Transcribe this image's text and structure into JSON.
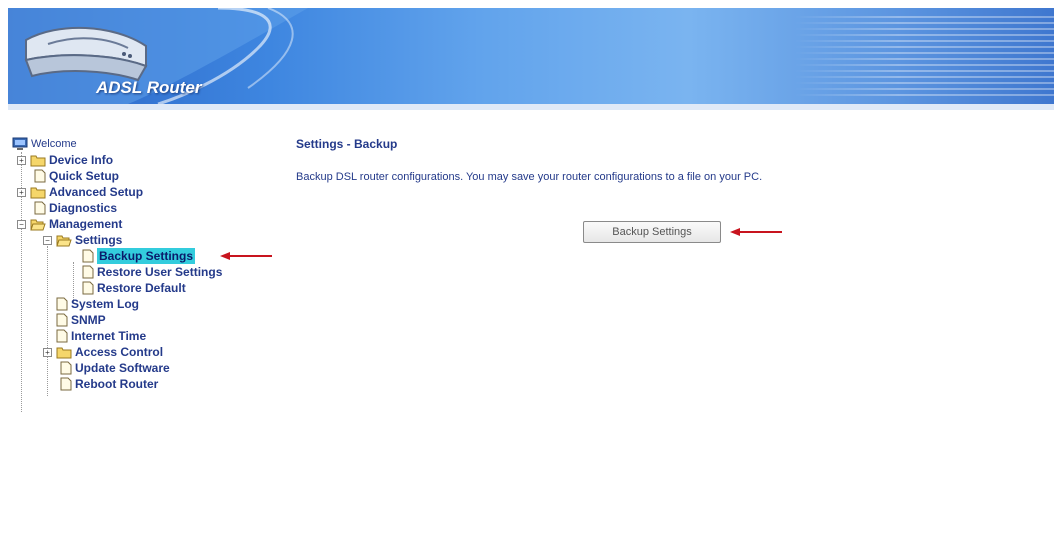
{
  "header": {
    "brand": "ADSL Router"
  },
  "tree": {
    "root": "Welcome",
    "items": [
      {
        "label": "Device Info"
      },
      {
        "label": "Quick Setup"
      },
      {
        "label": "Advanced Setup"
      },
      {
        "label": "Diagnostics"
      },
      {
        "label": "Management"
      },
      {
        "label": "Settings"
      },
      {
        "label": "Backup Settings"
      },
      {
        "label": "Restore User Settings"
      },
      {
        "label": "Restore Default"
      },
      {
        "label": "System Log"
      },
      {
        "label": "SNMP"
      },
      {
        "label": "Internet Time"
      },
      {
        "label": "Access Control"
      },
      {
        "label": "Update Software"
      },
      {
        "label": "Reboot Router"
      }
    ],
    "selected": "Backup Settings"
  },
  "content": {
    "title": "Settings - Backup",
    "description": "Backup DSL router configurations. You may save your router configurations to a file on your PC.",
    "button_label": "Backup Settings"
  },
  "colors": {
    "link_text": "#243a8a",
    "selected_bg": "#33ccdd",
    "arrow": "#c8141e"
  }
}
